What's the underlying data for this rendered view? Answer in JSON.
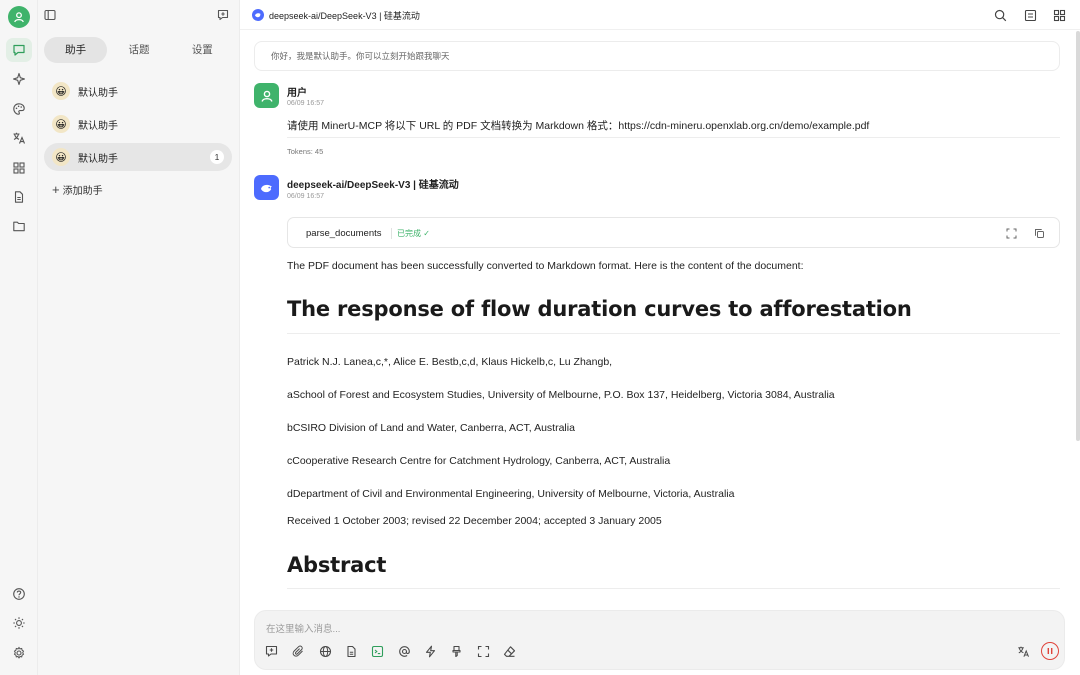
{
  "rail": {
    "icons": [
      "chat-icon",
      "sparkle-icon",
      "palette-icon",
      "translate-icon",
      "apps-icon",
      "file-icon",
      "folder-icon",
      "help-icon",
      "theme-icon",
      "settings-icon"
    ]
  },
  "panel": {
    "tabs": [
      {
        "label": "助手",
        "active": true
      },
      {
        "label": "话题",
        "active": false
      },
      {
        "label": "设置",
        "active": false
      }
    ],
    "assistants": [
      {
        "label": "默认助手",
        "emoji": "😀",
        "badge": ""
      },
      {
        "label": "默认助手",
        "emoji": "😀",
        "badge": ""
      },
      {
        "label": "默认助手",
        "emoji": "😀",
        "badge": "1"
      }
    ],
    "add_label": "添加助手"
  },
  "topbar": {
    "title": "deepseek-ai/DeepSeek-V3 | 硅基流动"
  },
  "banner": "你好，我是默认助手。你可以立刻开始跟我聊天",
  "user_message": {
    "name": "用户",
    "time": "06/09 16:57",
    "text": "请使用 MinerU-MCP 将以下 URL 的 PDF 文档转换为 Markdown 格式：https://cdn-mineru.openxlab.org.cn/demo/example.pdf",
    "tokens": "Tokens: 45"
  },
  "assistant_message": {
    "name": "deepseek-ai/DeepSeek-V3 | 硅基流动",
    "time": "06/09 16:57",
    "tool": {
      "name": "parse_documents",
      "status": "已完成 ✓"
    },
    "intro": "The PDF document has been successfully converted to Markdown format. Here is the content of the document:",
    "heading": "The response of flow duration curves to afforestation",
    "paragraphs": [
      "Patrick N.J. Lanea,c,*, Alice E. Bestb,c,d, Klaus Hickelb,c, Lu Zhangb,",
      "aSchool of Forest and Ecosystem Studies, University of Melbourne, P.O. Box 137, Heidelberg, Victoria 3084, Australia",
      "bCSIRO Division of Land and Water, Canberra, ACT, Australia",
      "cCooperative Research Centre for Catchment Hydrology, Canberra, ACT, Australia",
      "dDepartment of Civil and Environmental Engineering, University of Melbourne, Victoria, Australia",
      "Received 1 October 2003; revised 22 December 2004; accepted 3 January 2005"
    ],
    "heading2": "Abstract"
  },
  "input": {
    "placeholder": "在这里输入消息..."
  },
  "colors": {
    "accent": "#3fb36b",
    "deepseek": "#4d6bfe",
    "stop": "#e0433a"
  }
}
